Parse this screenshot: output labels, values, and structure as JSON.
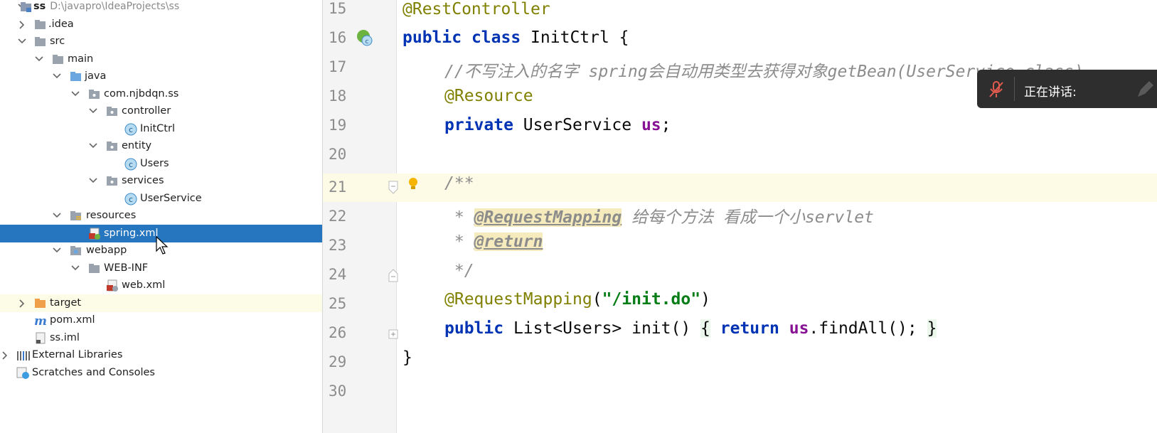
{
  "project_tree": {
    "root": {
      "name": "ss",
      "path": "D:\\javapro\\IdeaProjects\\ss"
    },
    "items": [
      {
        "label": ".idea"
      },
      {
        "label": "src"
      },
      {
        "label": "main"
      },
      {
        "label": "java"
      },
      {
        "label": "com.njbdqn.ss"
      },
      {
        "label": "controller"
      },
      {
        "label": "InitCtrl"
      },
      {
        "label": "entity"
      },
      {
        "label": "Users"
      },
      {
        "label": "services"
      },
      {
        "label": "UserService"
      },
      {
        "label": "resources"
      },
      {
        "label": "spring.xml"
      },
      {
        "label": "webapp"
      },
      {
        "label": "WEB-INF"
      },
      {
        "label": "web.xml"
      },
      {
        "label": "target"
      },
      {
        "label": "pom.xml"
      },
      {
        "label": "ss.iml"
      },
      {
        "label": "External Libraries"
      },
      {
        "label": "Scratches and Consoles"
      }
    ]
  },
  "editor": {
    "line_numbers": [
      "15",
      "16",
      "17",
      "18",
      "19",
      "20",
      "21",
      "22",
      "23",
      "24",
      "25",
      "26",
      "29",
      "30"
    ],
    "code": {
      "l15": "@RestController",
      "l16_kw1": "public",
      "l16_kw2": "class",
      "l16_rest": " InitCtrl {",
      "l17": "//不写注入的名字 spring会自动用类型去获得对象getBean(UserService.class)",
      "l18": "@Resource",
      "l19_kw": "private",
      "l19_type": " UserService ",
      "l19_field": "us",
      "l19_end": ";",
      "l21": "/**",
      "l22_star": " * ",
      "l22_tag": "@RequestMapping",
      "l22_text": " 给每个方法 看成一个小servlet",
      "l23_star": " * ",
      "l23_tag": "@return",
      "l24": " */",
      "l25_ann": "@RequestMapping",
      "l25_open": "(",
      "l25_str": "\"/init.do\"",
      "l25_close": ")",
      "l26_kw": "public",
      "l26_sig": " List<Users> init() ",
      "l26_ob": "{",
      "l26_kw2": "return",
      "l26_field": "us",
      "l26_call": ".findAll(); ",
      "l26_cb": "}",
      "l29": "}"
    }
  },
  "overlay": {
    "speaking_label": "正在讲话:"
  },
  "colors": {
    "selection": "#2675bf",
    "current_line": "#fdfbe5",
    "overlay_bg": "#2e2e2e"
  }
}
